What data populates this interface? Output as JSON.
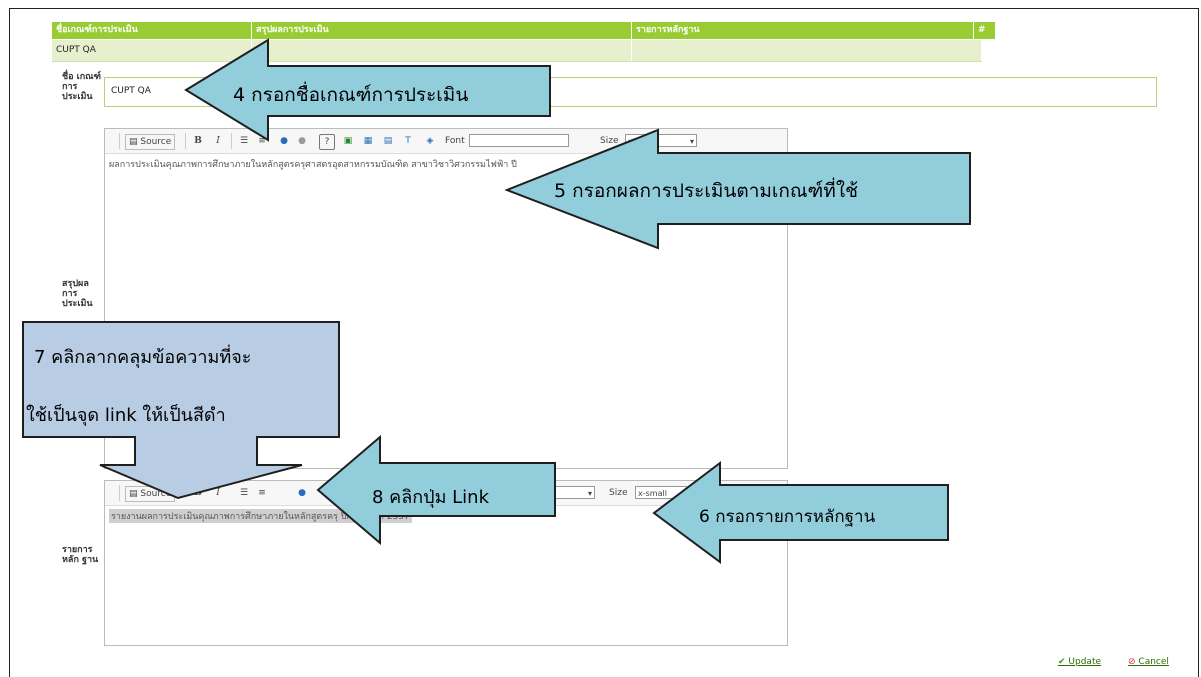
{
  "header": {
    "columns": [
      "ชื่อเกณฑ์การประเมิน",
      "สรุปผลการประเมิน",
      "รายการหลักฐาน",
      "#"
    ]
  },
  "row": {
    "name": "CUPT QA"
  },
  "form": {
    "name_label": "ชื่อ เกณฑ์ การ ประเมิน",
    "name_value": "CUPT QA",
    "summary_label": "สรุปผล การ ประเมิน",
    "summary_text": "ผลการประเมินคุณภาพการศึกษาภายในหลักสูตรครุศาสตรอุตสาหกรรมบัณฑิต สาขาวิชาวิศวกรรมไฟฟ้า ปี",
    "evidence_label": "รายการ หลัก ฐาน",
    "evidence_text": "รายงานผลการประเมินคุณภาพการศึกษาภายในหลักสูตรครุ",
    "evidence_text_end": "ปีการศึกษา 2557"
  },
  "toolbar": {
    "source": "Source",
    "bold": "B",
    "italic": "I",
    "font_label": "Font",
    "size_label": "Size",
    "size_value": "x-small"
  },
  "annotations": {
    "a4": "4 กรอกชื่อเกณฑ์การประเมิน",
    "a5": "5 กรอกผลการประเมินตามเกณฑ์ที่ใช้",
    "a6": "6 กรอกรายการหลักฐาน",
    "a7_line1": "7 คลิกลากคลุมข้อความที่จะ",
    "a7_line2": "ใช้เป็นจุด link ให้เป็นสีดำ",
    "a8": "8 คลิกปุ่ม Link"
  },
  "actions": {
    "update": "Update",
    "cancel": "Cancel"
  },
  "colors": {
    "accent": "#99cc33",
    "row_bg": "#e6f0cd",
    "arrow": "#92cddc",
    "box": "#b8cce4"
  }
}
